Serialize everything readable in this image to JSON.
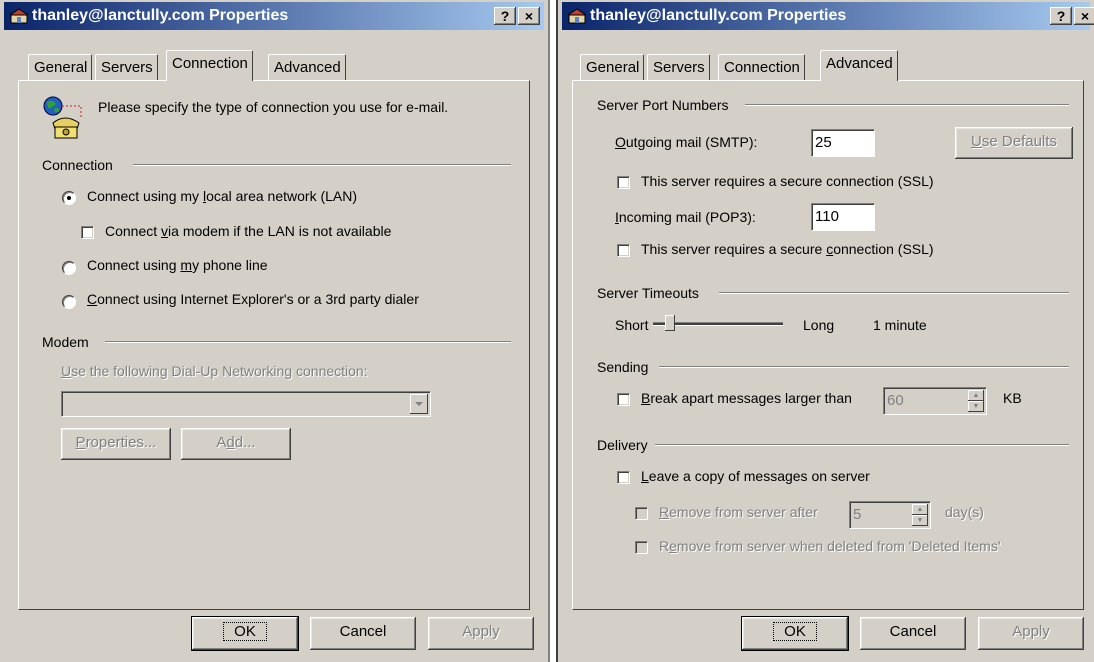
{
  "left_window": {
    "title": "thanley@lanctully.com Properties",
    "help_button": "?",
    "close_button": "×",
    "tabs": [
      "General",
      "Servers",
      "Connection",
      "Advanced"
    ],
    "active_tab": "Connection",
    "intro_text": "Please specify the type of connection you use for e-mail.",
    "connection_group": "Connection",
    "options": {
      "lan_pre": "Connect using my ",
      "lan_key": "l",
      "lan_post": "ocal area network (LAN)",
      "modem_fallback_pre": "Connect ",
      "modem_fallback_key": "v",
      "modem_fallback_post": "ia modem if the LAN is not available",
      "phone_pre": "Connect using ",
      "phone_key": "m",
      "phone_post": "y phone line",
      "dialer_pre": "",
      "dialer_key": "C",
      "dialer_post": "onnect using Internet Explorer's or a 3rd party dialer"
    },
    "selected_option": "lan",
    "modem_group": "Modem",
    "dialup_label_key": "U",
    "dialup_label_post": "se the following Dial-Up Networking connection:",
    "dialup_value": "",
    "properties_key": "P",
    "properties_post": "roperties...",
    "add_pre": "A",
    "add_key": "d",
    "add_post": "d...",
    "ok": "OK",
    "cancel": "Cancel",
    "apply": "Apply"
  },
  "right_window": {
    "title": "thanley@lanctully.com Properties",
    "help_button": "?",
    "close_button": "×",
    "tabs": [
      "General",
      "Servers",
      "Connection",
      "Advanced"
    ],
    "active_tab": "Advanced",
    "ports_group": "Server Port Numbers",
    "smtp_key": "O",
    "smtp_post": "utgoing mail (SMTP):",
    "smtp_value": "25",
    "use_defaults_key": "U",
    "use_defaults_post": "se Defaults",
    "smtp_ssl": "This server requires a secure connection (SSL)",
    "pop3_key": "I",
    "pop3_post": "ncoming mail (POP3):",
    "pop3_value": "110",
    "pop3_ssl_pre": "This server requires a secure ",
    "pop3_ssl_key": "c",
    "pop3_ssl_post": "onnection (SSL)",
    "timeouts_group": "Server Timeouts",
    "timeout_short": "Short",
    "timeout_long": "Long",
    "timeout_value": "1 minute",
    "timeout_slider_fraction": 0.1,
    "sending_group": "Sending",
    "break_key": "B",
    "break_post": "reak apart messages larger than",
    "break_value": "60",
    "break_unit": "KB",
    "delivery_group": "Delivery",
    "leave_key": "L",
    "leave_post": "eave a copy of messages on server",
    "remove_after_key": "R",
    "remove_after_post": "emove from server after",
    "remove_after_value": "5",
    "remove_after_unit": "day(s)",
    "remove_deleted_pre": "R",
    "remove_deleted_key": "e",
    "remove_deleted_post": "move from server when deleted from 'Deleted Items'",
    "ok": "OK",
    "cancel": "Cancel",
    "apply": "Apply"
  }
}
